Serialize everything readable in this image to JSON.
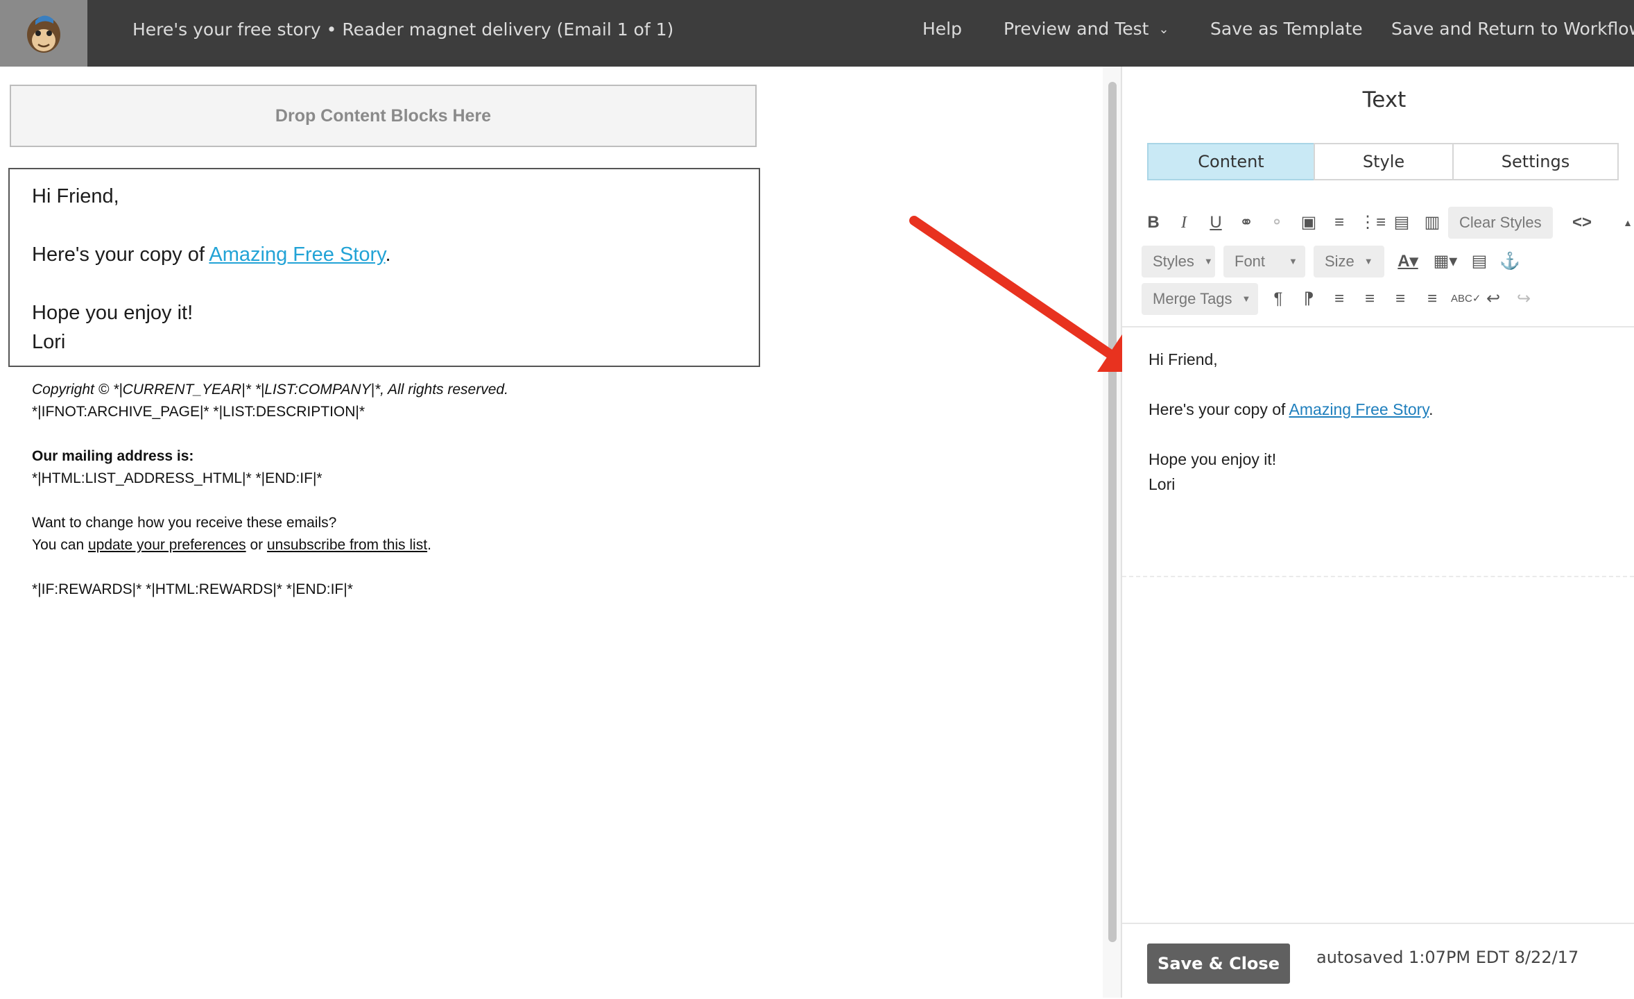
{
  "app": {
    "logo": "mailchimp-monkey-logo",
    "document_title": "Here's your free story • Reader magnet delivery (Email 1 of 1)"
  },
  "nav": {
    "help": "Help",
    "preview_and_test": "Preview and Test",
    "save_as_template": "Save as Template",
    "save_and_return": "Save and Return to Workflow"
  },
  "canvas": {
    "drop_zone": "Drop Content Blocks Here",
    "text_block": {
      "greeting": "Hi Friend,",
      "copy_prefix": "Here's your copy of ",
      "link_text": "Amazing Free Story",
      "copy_suffix": ".",
      "closing": "Hope you enjoy it!",
      "signature": "Lori"
    },
    "footer": {
      "copyright": "Copyright © *|CURRENT_YEAR|* *|LIST:COMPANY|*, All rights reserved.",
      "description": "*|IFNOT:ARCHIVE_PAGE|* *|LIST:DESCRIPTION|*",
      "mailing_heading": "Our mailing address is:",
      "mailing_address": "*|HTML:LIST_ADDRESS_HTML|* *|END:IF|*",
      "change_question": "Want to change how you receive these emails?",
      "you_can": "You can ",
      "update_prefs": "update your preferences",
      "or": " or ",
      "unsubscribe": "unsubscribe from this list",
      "period": ".",
      "rewards": "*|IF:REWARDS|* *|HTML:REWARDS|* *|END:IF|*"
    }
  },
  "panel": {
    "title": "Text",
    "tabs": [
      "Content",
      "Style",
      "Settings"
    ],
    "active_tab": "Content",
    "toolbar": {
      "clear_styles": "Clear Styles",
      "styles": "Styles",
      "font": "Font",
      "size": "Size",
      "merge_tags": "Merge Tags"
    },
    "editor": {
      "greeting": "Hi Friend,",
      "copy_prefix": "Here's your copy of ",
      "link_text": "Amazing Free Story",
      "copy_suffix": ".",
      "closing": "Hope you enjoy it!",
      "signature": "Lori"
    },
    "save_close": "Save & Close",
    "autosave": "autosaved 1:07PM EDT 8/22/17"
  },
  "colors": {
    "topbar": "#3d3d3d",
    "active_tab": "#c9e9f5",
    "link": "#22a3d6",
    "annotation_arrow": "#e8321f"
  }
}
